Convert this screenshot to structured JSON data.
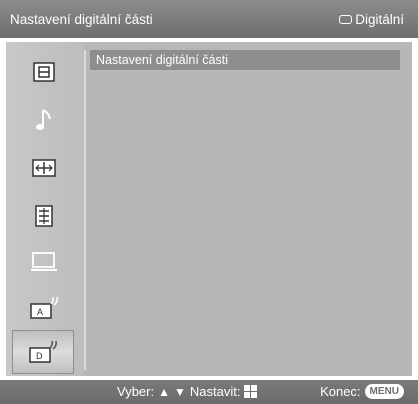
{
  "header": {
    "title": "Nastavení digitální části",
    "source_label": "Digitální",
    "source_icon": "tv-screen-icon"
  },
  "sidebar": {
    "items": [
      {
        "icon": "picture-icon",
        "selected": false
      },
      {
        "icon": "music-note-icon",
        "selected": false
      },
      {
        "icon": "screen-settings-icon",
        "selected": false
      },
      {
        "icon": "list-settings-icon",
        "selected": false
      },
      {
        "icon": "pc-monitor-icon",
        "selected": false
      },
      {
        "icon": "analog-setup-icon",
        "selected": false
      },
      {
        "icon": "digital-setup-icon",
        "selected": true
      }
    ]
  },
  "content": {
    "items": [
      {
        "label": "Nastavení digitální části"
      }
    ]
  },
  "footer": {
    "select_label": "Vyber:",
    "set_label": "Nastavit:",
    "exit_label": "Konec:",
    "menu_key": "MENU"
  },
  "colors": {
    "bar": "#7a7a7a",
    "panel": "#b7b7b7",
    "highlight": "#8e8e8e"
  }
}
